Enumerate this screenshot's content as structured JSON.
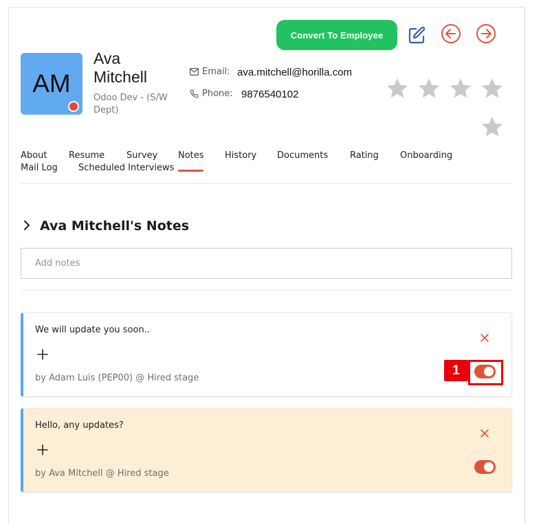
{
  "header": {
    "convert_label": "Convert To Employee"
  },
  "candidate": {
    "initials": "AM",
    "name": "Ava Mitchell",
    "role": "Odoo Dev - (S/W Dept)",
    "email_label": "Email:",
    "email": "ava.mitchell@horilla.com",
    "phone_label": "Phone:",
    "phone": "9876540102",
    "rating": 0,
    "rating_max": 5
  },
  "tabs": [
    {
      "label": "About"
    },
    {
      "label": "Resume"
    },
    {
      "label": "Survey"
    },
    {
      "label": "Notes",
      "active": true
    },
    {
      "label": "History"
    },
    {
      "label": "Documents"
    },
    {
      "label": "Rating"
    },
    {
      "label": "Onboarding"
    },
    {
      "label": "Mail Log"
    },
    {
      "label": "Scheduled Interviews"
    }
  ],
  "notes": {
    "title": "Ava Mitchell's Notes",
    "input_placeholder": "Add notes",
    "items": [
      {
        "text": "We will update you soon..",
        "meta": "by  Adam Luis (PEP00) @ Hired stage",
        "toggle_on": true,
        "bg": "#ffffff"
      },
      {
        "text": "Hello, any updates?",
        "meta": "by  Ava Mitchell @ Hired stage",
        "toggle_on": true,
        "bg": "#fdefd6"
      }
    ]
  },
  "annotation": {
    "badge": "1"
  },
  "colors": {
    "accent": "#e0533a",
    "convert": "#22c261",
    "avatar": "#62aaf0",
    "note_border": "#5aa6ee",
    "highlight": "#e8000b"
  }
}
